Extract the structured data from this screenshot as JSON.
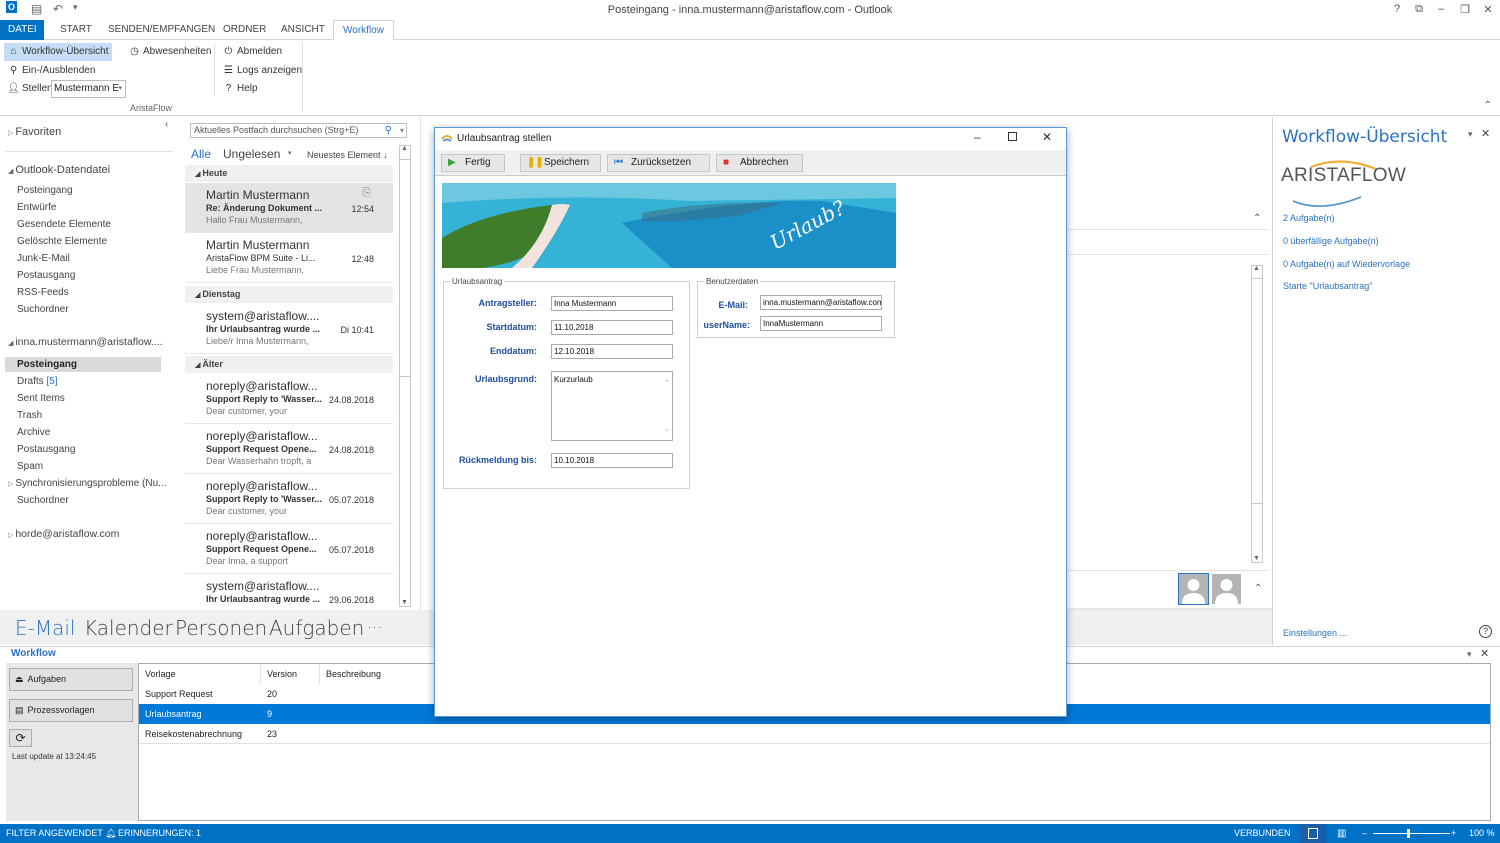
{
  "window": {
    "title": "Posteingang - inna.mustermann@aristaflow.com - Outlook",
    "controls": {
      "help": "?",
      "ribbon_display": "⧉",
      "minimize": "–",
      "restore": "❐",
      "close": "✕"
    }
  },
  "ribbon": {
    "tabs": [
      {
        "label": "DATEI"
      },
      {
        "label": "START"
      },
      {
        "label": "SENDEN/EMPFANGEN"
      },
      {
        "label": "ORDNER"
      },
      {
        "label": "ANSICHT"
      },
      {
        "label": "Workflow",
        "active": true
      }
    ],
    "buttons": {
      "overview": "Workflow-Übersicht",
      "toggle": "Ein-/Ausblenden",
      "roles": "Stellen",
      "roles_value": "Mustermann E",
      "absences": "Abwesenheiten",
      "logout": "Abmelden",
      "logs": "Logs anzeigen",
      "help": "Help"
    },
    "group_label": "AristaFlow"
  },
  "nav": {
    "favorites": "Favoriten",
    "data_file": {
      "label": "Outlook-Datendatei",
      "items": [
        "Posteingang",
        "Entwürfe",
        "Gesendete Elemente",
        "Gelöschte Elemente",
        "Junk-E-Mail",
        "Postausgang",
        "RSS-Feeds",
        "Suchordner"
      ]
    },
    "account": {
      "label": "inna.mustermann@aristaflow....",
      "items": [
        {
          "label": "Posteingang",
          "selected": true
        },
        {
          "label": "Drafts",
          "count": "[5]"
        },
        {
          "label": "Sent Items"
        },
        {
          "label": "Trash"
        },
        {
          "label": "Archive"
        },
        {
          "label": "Postausgang"
        },
        {
          "label": "Spam"
        },
        {
          "label": "Synchronisierungsprobleme (Nu..."
        },
        {
          "label": "Suchordner"
        }
      ]
    },
    "account2": "horde@aristaflow.com"
  },
  "maillist": {
    "search_placeholder": "Aktuelles Postfach durchsuchen (Strg+E)",
    "filter_all": "Alle",
    "filter_unread": "Ungelesen",
    "sort": "Neuestes Element",
    "groups": {
      "today": "Heute",
      "tuesday": "Dienstag",
      "older": "Älter"
    },
    "items": [
      {
        "from": "Martin Mustermann",
        "subject": "Re: Änderung Dokument ...",
        "preview": "Hallo Frau Mustermann,",
        "time": "12:54",
        "attachment": true
      },
      {
        "from": "Martin Mustermann",
        "subject": "AristaFlow BPM Suite - Li...",
        "preview": "Liebe Frau Mustermann,",
        "time": "12:48"
      },
      {
        "from": "system@aristaflow....",
        "subject": "Ihr Urlaubsantrag wurde ...",
        "preview": "Liebe/r Inna Mustermann,",
        "time": "Di 10:41"
      },
      {
        "from": "noreply@aristaflow...",
        "subject": "Support Reply to 'Wasser...",
        "preview": "Dear customer,  your",
        "time": "24.08.2018"
      },
      {
        "from": "noreply@aristaflow...",
        "subject": "Support Request Opene...",
        "preview": "Dear Wasserhahn tropft,  a",
        "time": "24.08.2018"
      },
      {
        "from": "noreply@aristaflow...",
        "subject": "Support Reply to 'Wasser...",
        "preview": "Dear customer,  your",
        "time": "05.07.2018"
      },
      {
        "from": "noreply@aristaflow...",
        "subject": "Support Request Opene...",
        "preview": "Dear Inna,  a support",
        "time": "05.07.2018"
      },
      {
        "from": "system@aristaflow....",
        "subject": "Ihr Urlaubsantrag wurde ...",
        "preview": "",
        "time": "29.06.2018"
      }
    ]
  },
  "dialog": {
    "title": "Urlaubsantrag stellen",
    "toolbar": {
      "done": "Fertig",
      "save": "Speichern",
      "reset": "Zurücksetzen",
      "cancel": "Abbrechen"
    },
    "banner_text": "Urlaub?",
    "request_group": "Urlaubsantrag",
    "fields": {
      "applicant_label": "Antragsteller:",
      "applicant": "Inna Mustermann",
      "start_label": "Startdatum:",
      "start": "11.10.2018",
      "end_label": "Enddatum:",
      "end": "12.10.2018",
      "reason_label": "Urlaubsgrund:",
      "reason": "Kurzurlaub",
      "reply_label": "Rückmeldung bis:",
      "reply": "10.10.2018"
    },
    "user_group": "Benutzerdaten",
    "user": {
      "email_label": "E-Mail:",
      "email": "inna.mustermann@aristaflow.com",
      "username_label": "userName:",
      "username": "InnaMustermann"
    }
  },
  "right_pane": {
    "title": "Workflow-Übersicht",
    "logo": "ARISTAFLOW",
    "links": [
      "2 Aufgabe(n)",
      "0 überfällige Aufgabe(n)",
      "0 Aufgabe(n) auf Wiedervorlage",
      "Starte \"Urlaubsantrag\""
    ],
    "settings": "Einstellungen ..."
  },
  "bottom_nav": {
    "items": [
      "E-Mail",
      "Kalender",
      "Personen",
      "Aufgaben"
    ],
    "more": "···",
    "active_color": "#2b72c2"
  },
  "workflow_pane": {
    "title": "Workflow",
    "buttons": {
      "tasks": "Aufgaben",
      "templates": "Prozessvorlagen"
    },
    "last_update": "Last update at 13:24:45",
    "columns": [
      "Vorlage",
      "Version",
      "Beschreibung"
    ],
    "rows": [
      {
        "template": "Support Request",
        "version": "20",
        "description": ""
      },
      {
        "template": "Urlaubsantrag",
        "version": "9",
        "description": "",
        "selected": true
      },
      {
        "template": "Reisekostenabrechnung",
        "version": "23",
        "description": ""
      }
    ]
  },
  "status": {
    "filter": "FILTER ANGEWENDET",
    "reminders": "ERINNERUNGEN: 1",
    "connected": "VERBUNDEN",
    "zoom": "100 %",
    "zoom_value": 100
  },
  "colors": {
    "accent": "#0072c6",
    "selection": "#0078d7",
    "label_blue": "#1e4f9c"
  }
}
